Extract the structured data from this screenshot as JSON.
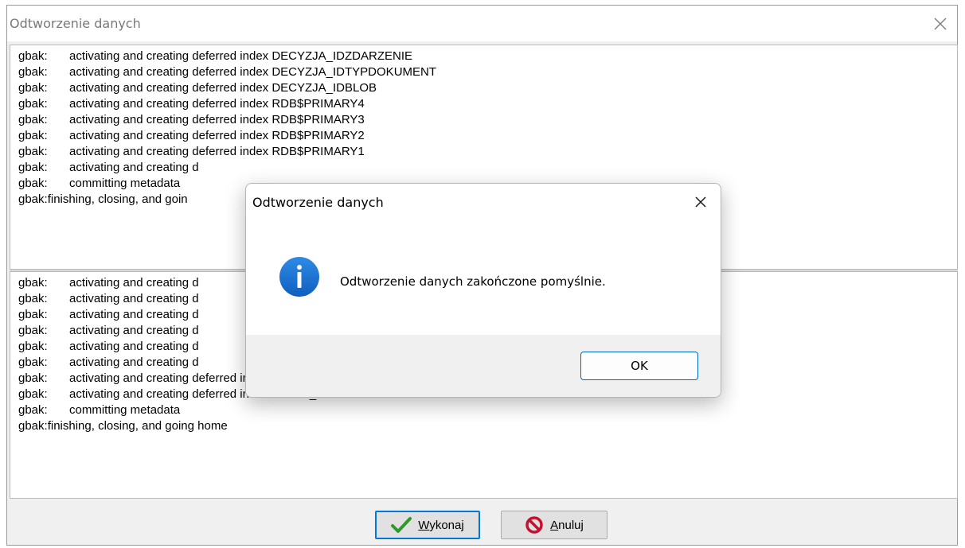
{
  "window": {
    "title": "Odtworzenie danych",
    "close_icon": "close-icon"
  },
  "log_top": [
    {
      "prefix": "gbak:",
      "text": "activating and creating deferred index DECYZJA_IDZDARZENIE"
    },
    {
      "prefix": "gbak:",
      "text": "activating and creating deferred index DECYZJA_IDTYPDOKUMENT"
    },
    {
      "prefix": "gbak:",
      "text": "activating and creating deferred index DECYZJA_IDBLOB"
    },
    {
      "prefix": "gbak:",
      "text": "activating and creating deferred index RDB$PRIMARY4"
    },
    {
      "prefix": "gbak:",
      "text": "activating and creating deferred index RDB$PRIMARY3"
    },
    {
      "prefix": "gbak:",
      "text": "activating and creating deferred index RDB$PRIMARY2"
    },
    {
      "prefix": "gbak:",
      "text": "activating and creating deferred index RDB$PRIMARY1"
    },
    {
      "prefix": "gbak:",
      "text": "activating and creating d"
    },
    {
      "prefix": "gbak:",
      "text": "committing metadata"
    },
    {
      "prefix": "gbak:",
      "text": "finishing, closing, and goin"
    }
  ],
  "log_bottom": [
    {
      "prefix": "gbak:",
      "text": "activating and creating d"
    },
    {
      "prefix": "gbak:",
      "text": "activating and creating d"
    },
    {
      "prefix": "gbak:",
      "text": "activating and creating d"
    },
    {
      "prefix": "gbak:",
      "text": "activating and creating d"
    },
    {
      "prefix": "gbak:",
      "text": "activating and creating d"
    },
    {
      "prefix": "gbak:",
      "text": "activating and creating d"
    },
    {
      "prefix": "gbak:",
      "text": "activating and creating deferred index RDB$PRIMARY1"
    },
    {
      "prefix": "gbak:",
      "text": "activating and creating deferred index AKCJA_IDPRACOWNIK"
    },
    {
      "prefix": "gbak:",
      "text": "committing metadata"
    },
    {
      "prefix": "gbak:",
      "text": "finishing, closing, and going home"
    }
  ],
  "buttons": {
    "wykonaj_mnemonic": "W",
    "wykonaj_rest": "ykonaj",
    "wykonaj_icon": "checkmark-icon",
    "anuluj_mnemonic": "A",
    "anuluj_rest": "nuluj",
    "anuluj_icon": "no-entry-icon"
  },
  "dialog": {
    "title": "Odtworzenie danych",
    "message": "Odtworzenie danych zakończone pomyślnie.",
    "ok_label": "OK",
    "icon": "info-icon",
    "close_icon": "close-icon"
  },
  "colors": {
    "accent": "#0078d7",
    "info_icon": "#1a73d1",
    "check_green": "#2e9a2e",
    "cancel_red": "#c8102e"
  }
}
